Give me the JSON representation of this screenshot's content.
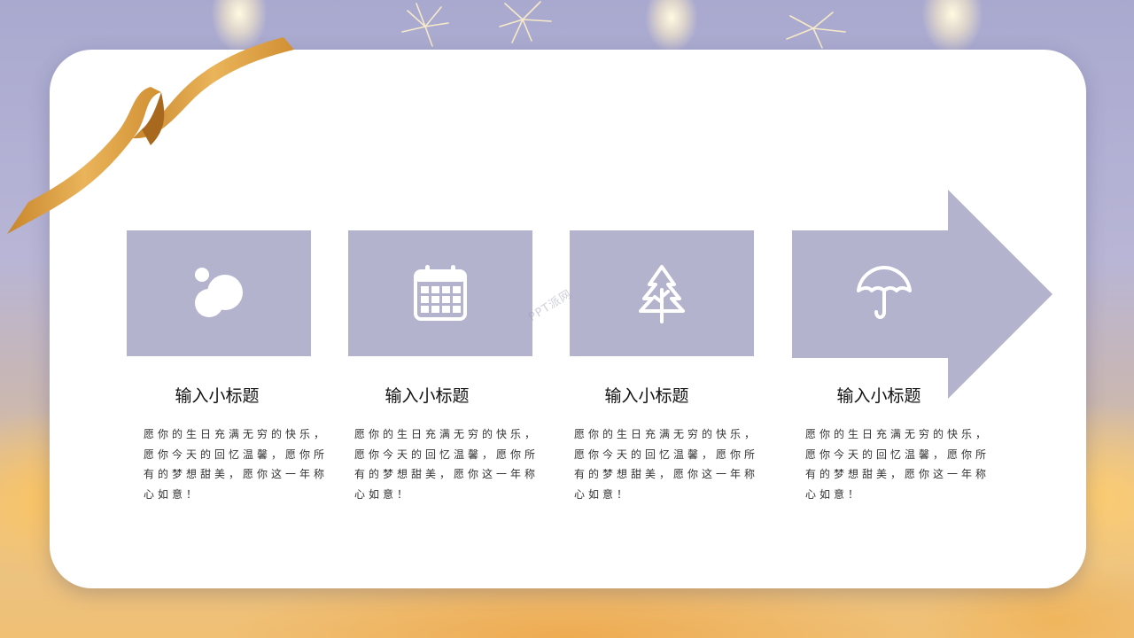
{
  "theme": {
    "accent": "#b4b3ce",
    "card_background": "#ffffff",
    "ribbon_color": "#d99a3a",
    "title_color": "#111111",
    "text_color": "#333333"
  },
  "steps": [
    {
      "icon": "bubbles-icon",
      "title": "输入小标题",
      "desc": "愿你的生日充满无穷的快乐，愿你今天的回忆温馨，愿你所有的梦想甜美，愿你这一年称心如意！"
    },
    {
      "icon": "calendar-icon",
      "title": "输入小标题",
      "desc": "愿你的生日充满无穷的快乐，愿你今天的回忆温馨，愿你所有的梦想甜美，愿你这一年称心如意！"
    },
    {
      "icon": "tree-icon",
      "title": "输入小标题",
      "desc": "愿你的生日充满无穷的快乐，愿你今天的回忆温馨，愿你所有的梦想甜美，愿你这一年称心如意！"
    },
    {
      "icon": "umbrella-icon",
      "title": "输入小标题",
      "desc": "愿你的生日充满无穷的快乐，愿你今天的回忆温馨，愿你所有的梦想甜美，愿你这一年称心如意！"
    }
  ],
  "watermark": "PPT派网"
}
